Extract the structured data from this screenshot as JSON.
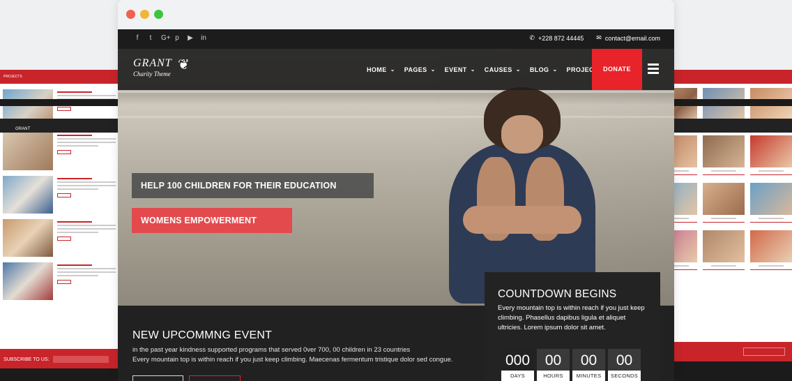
{
  "window": {
    "controls": [
      "close",
      "minimize",
      "maximize"
    ]
  },
  "topbar": {
    "socials": [
      {
        "icon": "facebook-icon",
        "glyph": "f"
      },
      {
        "icon": "twitter-icon",
        "glyph": "t"
      },
      {
        "icon": "google-plus-icon",
        "glyph": "G+"
      },
      {
        "icon": "pinterest-icon",
        "glyph": "p"
      },
      {
        "icon": "youtube-icon",
        "glyph": "▶"
      },
      {
        "icon": "linkedin-icon",
        "glyph": "in"
      }
    ],
    "phone": "+228 872 44445",
    "email": "contact@email.com"
  },
  "logo": {
    "name": "GRANT",
    "tagline": "Charity Theme"
  },
  "nav": {
    "items": [
      "HOME",
      "PAGES",
      "EVENT",
      "CAUSES",
      "BLOG",
      "PROJECTS"
    ],
    "donate": "DONATE"
  },
  "hero": {
    "tag1": "HELP 100 CHILDREN FOR THEIR EDUCATION",
    "tag2": "WOMENS EMPOWERMENT"
  },
  "event": {
    "title": "NEW UPCOMMNG EVENT",
    "line1": "in the past year kindness supported programs that served 0ver 700, 00 children in 23 countries",
    "line2": "Every mountain top is within reach if you just keep climbing. Maecenas fermentum tristique dolor sed congue."
  },
  "countdown": {
    "title": "COUNTDOWN BEGINS",
    "description": "Every mountain top is within reach if you just keep climbing. Phasellus dapibus ligula et aliquet ultricies. Lorem ipsum dolor sit amet.",
    "units": [
      {
        "value": "000",
        "label": "DAYS"
      },
      {
        "value": "00",
        "label": "HOURS"
      },
      {
        "value": "00",
        "label": "MINUTES"
      },
      {
        "value": "00",
        "label": "SECONDS"
      }
    ]
  },
  "side_left": {
    "section": "PROJECTS",
    "subscribe": "SUBSCRIBE TO US:"
  },
  "colors": {
    "accent": "#e8232a",
    "dark": "#1c1c1c",
    "tag_gray": "#505050",
    "tag_red": "#e34a4d"
  }
}
